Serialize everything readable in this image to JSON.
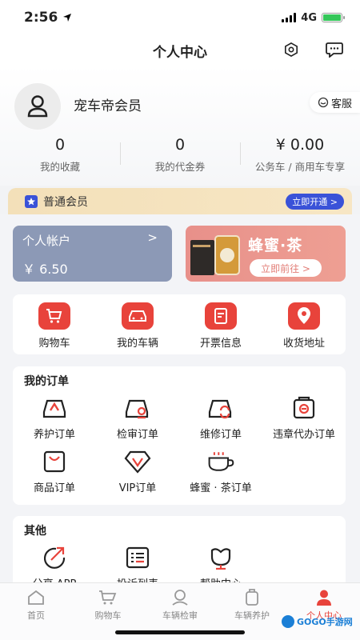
{
  "status_bar": {
    "time": "2:56",
    "network": "4G"
  },
  "header": {
    "title": "个人中心",
    "icons": [
      "settings-icon",
      "message-icon"
    ]
  },
  "profile": {
    "username": "宠车帝会员",
    "customer_service": "客服",
    "stats": [
      {
        "value": "0",
        "label": "我的收藏"
      },
      {
        "value": "0",
        "label": "我的代金券"
      },
      {
        "value": "¥ 0.00",
        "label": "公务车 / 商用车专享"
      }
    ]
  },
  "member": {
    "label": "普通会员",
    "action": "立即开通 >"
  },
  "account": {
    "title": "个人帐户",
    "arrow": ">",
    "balance": "￥ 6.50"
  },
  "promo": {
    "title": "蜂蜜·茶",
    "button": "立即前往 >"
  },
  "quick_actions": [
    {
      "label": "购物车",
      "icon": "cart-icon"
    },
    {
      "label": "我的车辆",
      "icon": "car-icon"
    },
    {
      "label": "开票信息",
      "icon": "invoice-icon"
    },
    {
      "label": "收货地址",
      "icon": "location-icon"
    }
  ],
  "orders": {
    "title": "我的订单",
    "items": [
      {
        "label": "养护订单",
        "icon": "maintenance-icon"
      },
      {
        "label": "检审订单",
        "icon": "inspection-icon"
      },
      {
        "label": "维修订单",
        "icon": "repair-icon"
      },
      {
        "label": "违章代办订单",
        "icon": "violation-icon"
      },
      {
        "label": "商品订单",
        "icon": "shopping-bag-icon"
      },
      {
        "label": "VIP订单",
        "icon": "diamond-icon"
      },
      {
        "label": "蜂蜜 · 茶订单",
        "icon": "teacup-icon"
      }
    ]
  },
  "other": {
    "title": "其他",
    "items": [
      {
        "label": "分享 APP",
        "icon": "share-icon"
      },
      {
        "label": "投诉列表",
        "icon": "list-icon"
      },
      {
        "label": "帮助中心",
        "icon": "help-icon"
      }
    ]
  },
  "tabs": [
    {
      "label": "首页",
      "icon": "home-icon",
      "active": false
    },
    {
      "label": "购物车",
      "icon": "cart-icon",
      "active": false
    },
    {
      "label": "车辆检审",
      "icon": "inspection-icon",
      "active": false
    },
    {
      "label": "车辆养护",
      "icon": "maintenance-icon",
      "active": false
    },
    {
      "label": "个人中心",
      "icon": "user-icon",
      "active": true
    }
  ],
  "watermark": "GOGO手游网",
  "colors": {
    "accent": "#e8433b",
    "member_button": "#3a52d8",
    "account_card": "#8c99b6"
  }
}
